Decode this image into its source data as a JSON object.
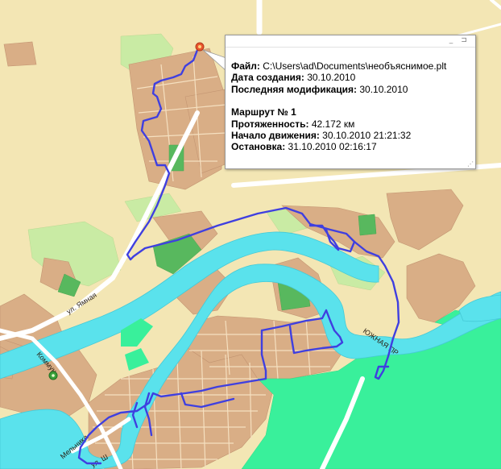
{
  "map": {
    "streets": [
      "ул. Ямная",
      "Коммун",
      "ул. Ш",
      "Мельника",
      "ЮЖНАЯ ПР"
    ],
    "colors": {
      "background": "#f3e6b4",
      "urban_block": "#d9ae86",
      "park_green": "#58b85e",
      "bright_green": "#39f09b",
      "light_green": "#c9eba4",
      "water": "#5ae2ec",
      "road": "#ffffff",
      "route": "#3f3fe0",
      "marker_start": "#e9562d",
      "marker_end": "#3aa03a"
    }
  },
  "popup": {
    "file_label": "Файл:",
    "file_value": "C:\\Users\\ad\\Documents\\необъяснимое.plt",
    "created_label": "Дата создания:",
    "created_value": "30.10.2010",
    "modified_label": "Последняя модификация:",
    "modified_value": "30.10.2010",
    "route_label": "Маршрут № 1",
    "length_label": "Протяженность:",
    "length_value": "42.172 км",
    "start_label": "Начало движения:",
    "start_value": "30.10.2010 21:21:32",
    "stop_label": "Остановка:",
    "stop_value": "31.10.2010 02:16:17",
    "minimize_glyph": "_",
    "pin_glyph": "⊐",
    "close_glyph": "×"
  }
}
